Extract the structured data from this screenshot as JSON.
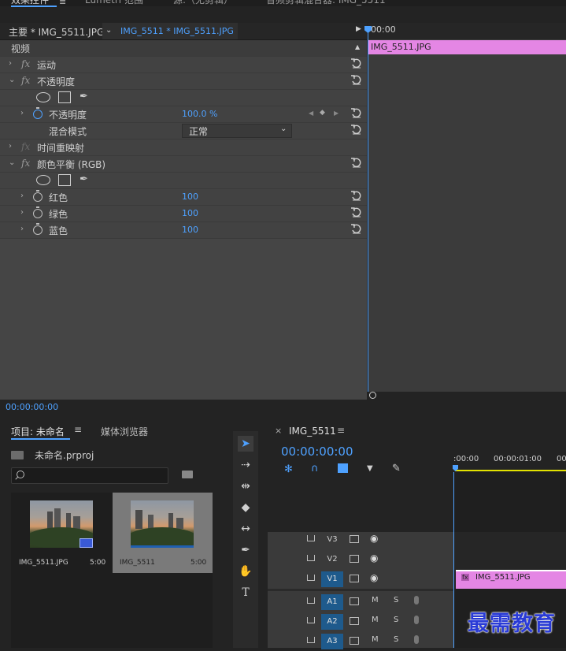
{
  "top_tabs": {
    "effect_controls": "效果控件",
    "lumetri": "Lumetri 范围",
    "source": "源:（无剪辑）",
    "audio_mixer": "音频剪辑混合器: IMG_5511"
  },
  "effect_controls": {
    "tab_master": "主要 * IMG_5511.JPG",
    "tab_clip": "IMG_5511 * IMG_5511.JPG",
    "section": "视频",
    "rows": [
      {
        "label": "运动"
      },
      {
        "label": "不透明度"
      },
      {
        "label": "不透明度",
        "value": "100.0 %"
      },
      {
        "label": "混合模式",
        "value": "正常"
      },
      {
        "label": "时间重映射"
      },
      {
        "label": "颜色平衡 (RGB)"
      },
      {
        "label": "红色",
        "value": "100"
      },
      {
        "label": "绿色",
        "value": "100"
      },
      {
        "label": "蓝色",
        "value": "100"
      }
    ],
    "fx_label": "fx",
    "timecode_ruler": "00:00",
    "clip_name": "IMG_5511.JPG",
    "current_time": "00:00:00:00"
  },
  "project": {
    "tab_project": "项目: 未命名",
    "tab_media_browser": "媒体浏览器",
    "file_name": "未命名.prproj",
    "search_placeholder": "",
    "items": [
      {
        "name": "IMG_5511.JPG",
        "duration": "5:00"
      },
      {
        "name": "IMG_5511",
        "duration": "5:00"
      }
    ]
  },
  "timeline": {
    "close": "×",
    "sequence_name": "IMG_5511",
    "timecode": "00:00:00:00",
    "ruler": [
      ":00:00",
      "00:00:01:00",
      "00"
    ],
    "tracks": [
      {
        "name": "V3"
      },
      {
        "name": "V2"
      },
      {
        "name": "V1"
      },
      {
        "name": "A1"
      },
      {
        "name": "A2"
      },
      {
        "name": "A3"
      }
    ],
    "m": "M",
    "s": "S",
    "clip_name": "IMG_5511.JPG"
  },
  "watermark": "最需教育",
  "colors": {
    "accent": "#4ea1ff",
    "clip": "#e486e4",
    "track_on": "#1e5a8c"
  }
}
